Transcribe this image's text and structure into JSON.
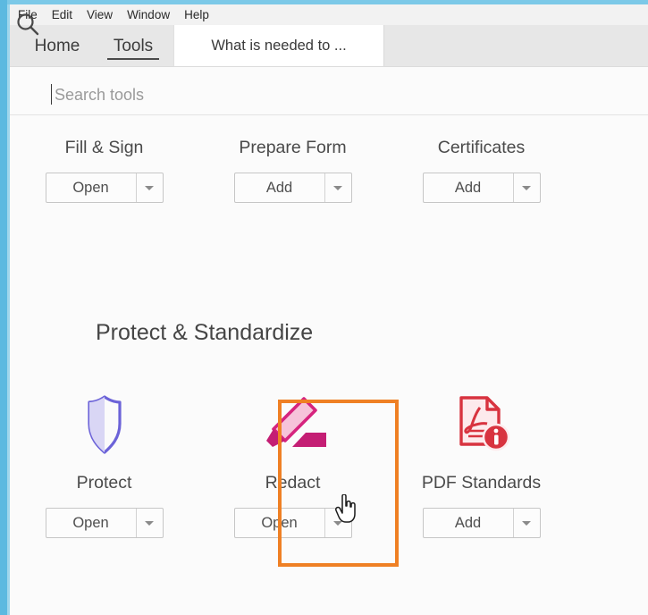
{
  "window": {
    "frame_color": "#5cb9e0",
    "chrome_color": "#7cc9e8"
  },
  "menubar": {
    "items": [
      {
        "label": "File"
      },
      {
        "label": "Edit"
      },
      {
        "label": "View"
      },
      {
        "label": "Window"
      },
      {
        "label": "Help"
      }
    ]
  },
  "tabs": {
    "app_tabs": [
      {
        "label": "Home",
        "active": false
      },
      {
        "label": "Tools",
        "active": true
      }
    ],
    "document_tab": {
      "label": "What is needed to ..."
    }
  },
  "search": {
    "icon": "search-icon",
    "placeholder": "Search tools",
    "value": ""
  },
  "sections": [
    {
      "heading": "",
      "tools": [
        {
          "label": "Fill & Sign",
          "icon": "sign-pen-icon",
          "icon_color": "#9b5fd6",
          "button": {
            "label": "Open",
            "has_dropdown": true
          }
        },
        {
          "label": "Prepare Form",
          "icon": "form-field-icon",
          "icon_color": "#d843d8",
          "button": {
            "label": "Add",
            "has_dropdown": true
          }
        },
        {
          "label": "Certificates",
          "icon": "certificate-seal-icon",
          "icon_color": "#2a9d97",
          "button": {
            "label": "Add",
            "has_dropdown": true
          }
        }
      ]
    },
    {
      "heading": "Protect & Standardize",
      "tools": [
        {
          "label": "Protect",
          "icon": "shield-icon",
          "icon_color": "#6c63d8",
          "button": {
            "label": "Open",
            "has_dropdown": true
          }
        },
        {
          "label": "Redact",
          "icon": "redact-marker-icon",
          "icon_color": "#d6247e",
          "button": {
            "label": "Open",
            "has_dropdown": true
          },
          "highlighted": true
        },
        {
          "label": "PDF Standards",
          "icon": "pdf-info-icon",
          "icon_color": "#d8333f",
          "button": {
            "label": "Add",
            "has_dropdown": true
          }
        }
      ]
    }
  ],
  "annotation": {
    "highlight_color": "#ef8024",
    "cursor": "hand-pointer-cursor"
  }
}
